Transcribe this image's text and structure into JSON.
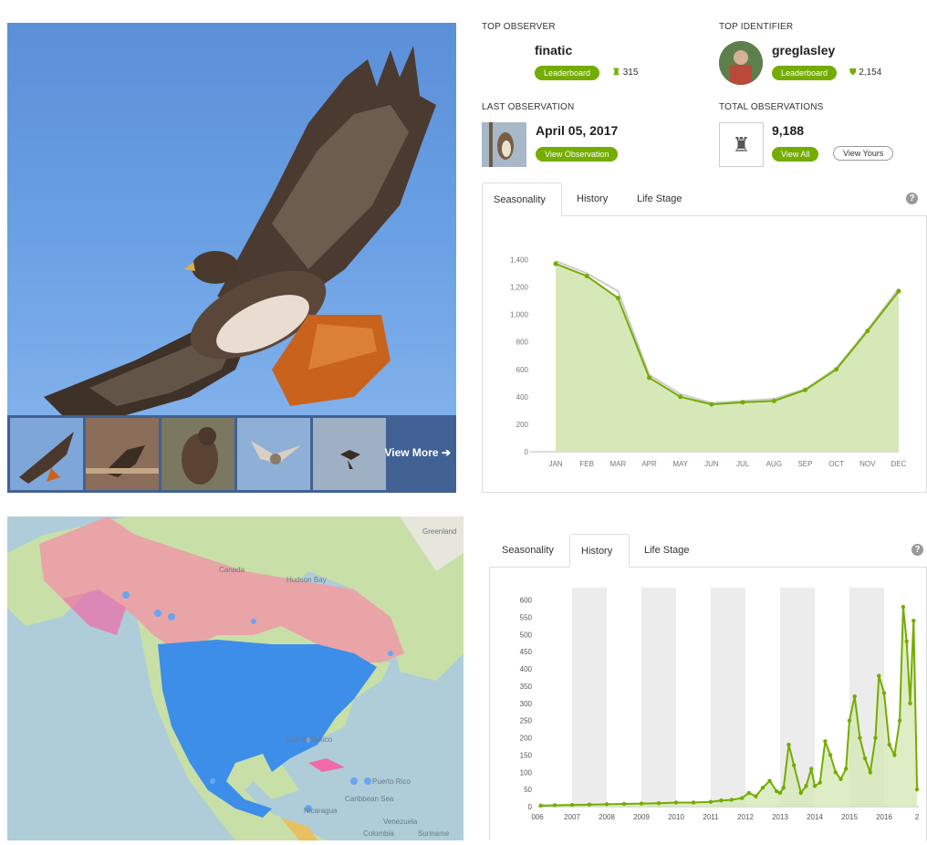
{
  "top_observer": {
    "label": "TOP OBSERVER",
    "name": "finatic",
    "button": "Leaderboard",
    "count": "315",
    "icon": "binoculars-icon"
  },
  "top_identifier": {
    "label": "TOP IDENTIFIER",
    "name": "greglasley",
    "button": "Leaderboard",
    "count": "2,154",
    "icon": "id-shield-icon"
  },
  "last_observation": {
    "label": "LAST OBSERVATION",
    "date": "April 05, 2017",
    "button": "View Observation"
  },
  "total_observations": {
    "label": "TOTAL OBSERVATIONS",
    "count": "9,188",
    "view_all": "View All",
    "view_yours": "View Yours"
  },
  "gallery": {
    "view_more": "View More"
  },
  "tabs": [
    "Seasonality",
    "History",
    "Life Stage"
  ],
  "colors": {
    "accent": "#74ac00",
    "area": "#d7e8b8",
    "range": "#e9a4a8",
    "obs": "#3d8ee8"
  },
  "map_labels": [
    "Greenland",
    "Canada",
    "Hudson Bay",
    "Gulf of Mexico",
    "Caribbean Sea",
    "Puerto Rico",
    "Venezuela",
    "Colombia",
    "Suriname",
    "Nicaragua"
  ],
  "chart_data": [
    {
      "type": "area",
      "categories": [
        "JAN",
        "FEB",
        "MAR",
        "APR",
        "MAY",
        "JUN",
        "JUL",
        "AUG",
        "SEP",
        "OCT",
        "NOV",
        "DEC"
      ],
      "series": [
        {
          "values": [
            1370,
            1280,
            1120,
            540,
            400,
            345,
            360,
            370,
            450,
            600,
            880,
            1170
          ]
        },
        {
          "values": [
            1390,
            1300,
            1170,
            560,
            420,
            355,
            370,
            385,
            455,
            610,
            890,
            1190
          ]
        }
      ],
      "yticks": [
        "1,400",
        "1,200",
        "1,000",
        "800",
        "600",
        "400",
        "200",
        "0"
      ],
      "ylim": [
        0,
        1450
      ],
      "grid": false
    },
    {
      "type": "line",
      "xticks": [
        "006",
        "2007",
        "2008",
        "2009",
        "2010",
        "2011",
        "2012",
        "2013",
        "2014",
        "2015",
        "2016",
        "2"
      ],
      "yticks": [
        "600",
        "550",
        "500",
        "450",
        "400",
        "350",
        "300",
        "250",
        "200",
        "150",
        "100",
        "50",
        "0"
      ],
      "ylim": [
        0,
        620
      ],
      "xlim": [
        2006.0,
        2017.0
      ],
      "x": [
        2006.1,
        2006.5,
        2007.0,
        2007.5,
        2008.0,
        2008.5,
        2009.0,
        2009.5,
        2010.0,
        2010.5,
        2011.0,
        2011.3,
        2011.6,
        2011.9,
        2012.1,
        2012.3,
        2012.5,
        2012.7,
        2012.9,
        2013.0,
        2013.1,
        2013.25,
        2013.4,
        2013.6,
        2013.75,
        2013.9,
        2014.0,
        2014.15,
        2014.3,
        2014.45,
        2014.6,
        2014.75,
        2014.9,
        2015.0,
        2015.15,
        2015.3,
        2015.45,
        2015.6,
        2015.75,
        2015.85,
        2016.0,
        2016.15,
        2016.3,
        2016.45,
        2016.55,
        2016.65,
        2016.75,
        2016.85,
        2016.95
      ],
      "y": [
        3,
        4,
        5,
        6,
        7,
        8,
        9,
        10,
        12,
        12,
        14,
        18,
        20,
        25,
        40,
        30,
        55,
        75,
        45,
        40,
        55,
        180,
        120,
        40,
        60,
        110,
        60,
        70,
        190,
        150,
        100,
        80,
        110,
        250,
        320,
        200,
        140,
        100,
        200,
        380,
        330,
        180,
        150,
        250,
        580,
        480,
        300,
        540,
        50
      ],
      "highlight_years": [
        2007,
        2009,
        2011,
        2013,
        2015
      ]
    }
  ]
}
